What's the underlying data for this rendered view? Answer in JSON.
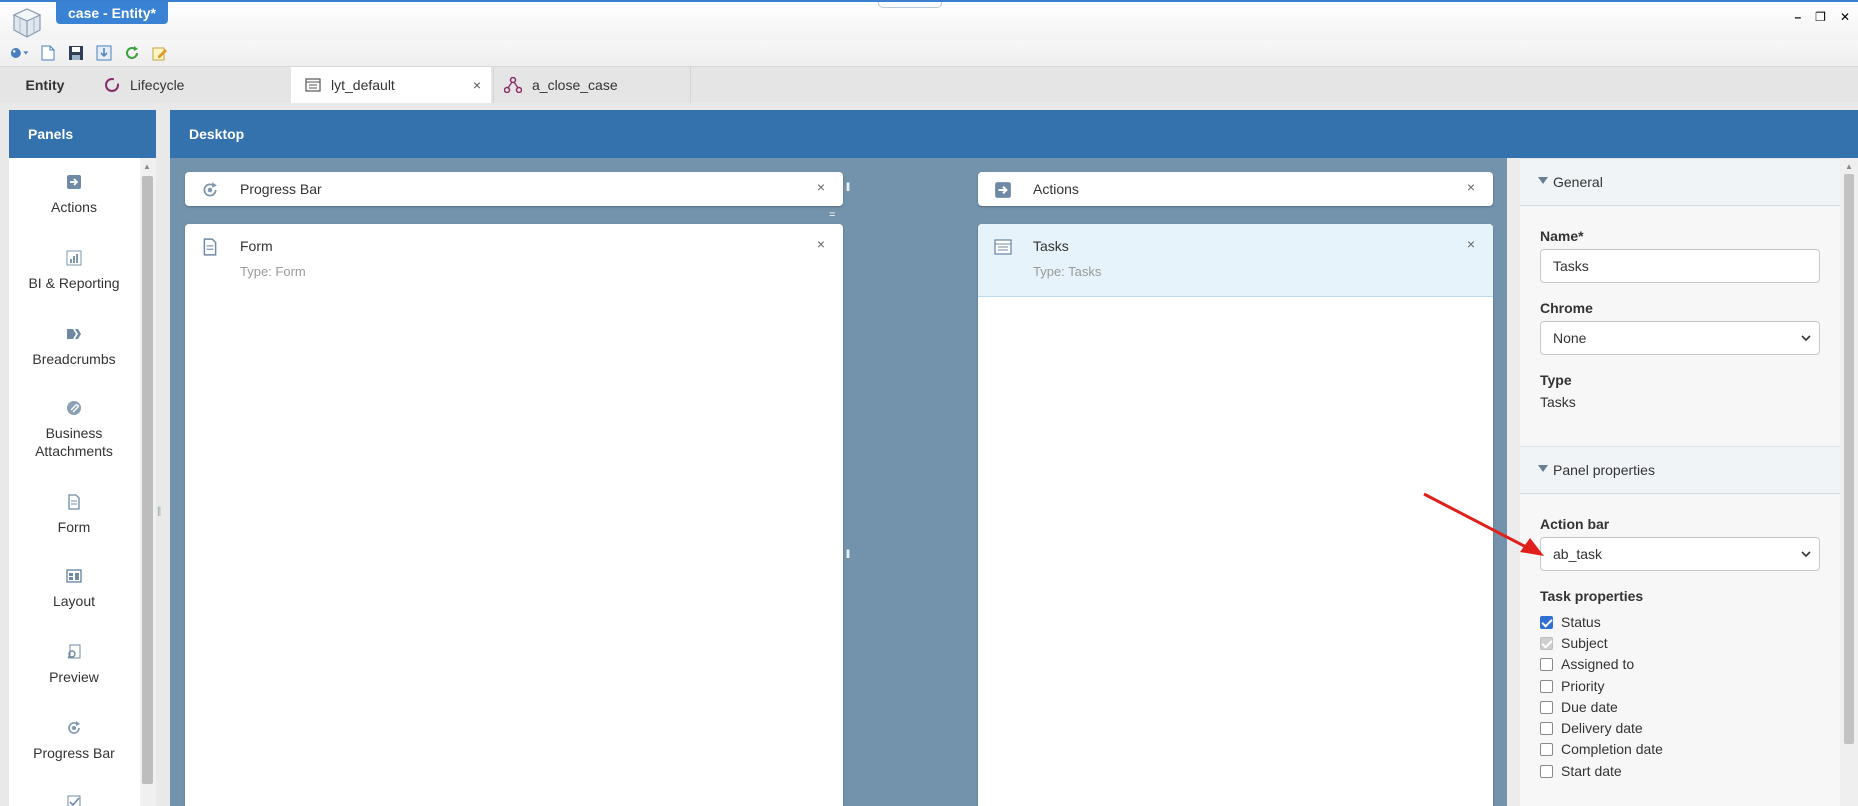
{
  "window": {
    "title": "case - Entity*",
    "controls": [
      "minimize-icon",
      "restore-icon",
      "close-icon"
    ]
  },
  "toolbar": {
    "buttons": [
      "palette-icon",
      "new-icon",
      "save-icon",
      "export-icon",
      "refresh-icon",
      "edit-icon"
    ]
  },
  "tabs": [
    {
      "label": "Entity",
      "icon": ""
    },
    {
      "label": "Lifecycle",
      "icon": "lifecycle-icon"
    },
    {
      "label": "lyt_default",
      "icon": "layout-icon",
      "close": "×"
    },
    {
      "label": "a_close_case",
      "icon": "action-flow-icon"
    }
  ],
  "panels": {
    "title": "Panels",
    "items": [
      {
        "label": "Actions",
        "icon": "actions-icon"
      },
      {
        "label": "BI & Reporting",
        "icon": "chart-icon"
      },
      {
        "label": "Breadcrumbs",
        "icon": "breadcrumbs-icon"
      },
      {
        "label": "Business Attachments",
        "icon": "attachment-icon"
      },
      {
        "label": "Form",
        "icon": "form-icon"
      },
      {
        "label": "Layout",
        "icon": "layout-icon"
      },
      {
        "label": "Preview",
        "icon": "preview-icon"
      },
      {
        "label": "Progress Bar",
        "icon": "progress-icon"
      }
    ]
  },
  "desktop": {
    "title": "Desktop",
    "cards": {
      "progress_bar": {
        "title": "Progress Bar",
        "close": "×"
      },
      "actions": {
        "title": "Actions",
        "close": "×"
      },
      "form": {
        "title": "Form",
        "type": "Type: Form",
        "close": "×"
      },
      "tasks": {
        "title": "Tasks",
        "type": "Type: Tasks",
        "close": "×"
      }
    }
  },
  "properties": {
    "general": {
      "header": "General",
      "name_label": "Name*",
      "name_value": "Tasks",
      "chrome_label": "Chrome",
      "chrome_value": "None",
      "type_label": "Type",
      "type_value": "Tasks"
    },
    "panel_properties": {
      "header": "Panel properties",
      "action_bar_label": "Action bar",
      "action_bar_value": "ab_task",
      "task_properties_label": "Task properties",
      "task_properties": [
        {
          "label": "Status",
          "state": "checked"
        },
        {
          "label": "Subject",
          "state": "disabled"
        },
        {
          "label": "Assigned to",
          "state": "unchecked"
        },
        {
          "label": "Priority",
          "state": "unchecked"
        },
        {
          "label": "Due date",
          "state": "unchecked"
        },
        {
          "label": "Delivery date",
          "state": "unchecked"
        },
        {
          "label": "Completion date",
          "state": "unchecked"
        },
        {
          "label": "Start date",
          "state": "unchecked"
        }
      ]
    }
  },
  "colors": {
    "header_blue": "#3472ae",
    "canvas": "#7393ac",
    "selected_card": "#e6f3fb",
    "arrow": "#e0201b"
  }
}
